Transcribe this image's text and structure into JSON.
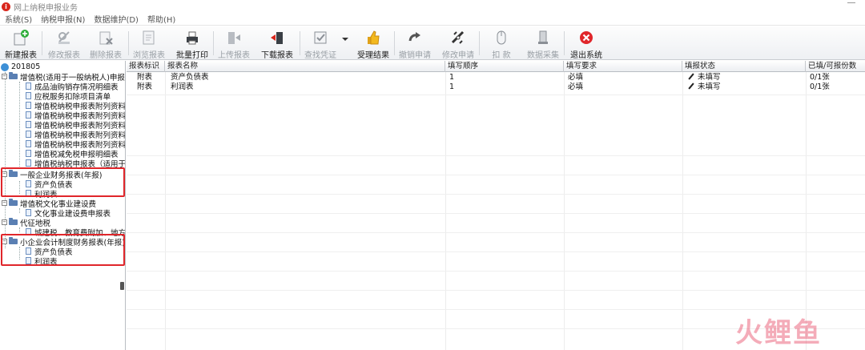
{
  "window": {
    "title": "网上纳税申报业务"
  },
  "menu": [
    "系统(S)",
    "纳税申报(N)",
    "数据维护(D)",
    "帮助(H)"
  ],
  "toolbar": [
    {
      "label": "新建报表",
      "icon": "new-report-icon",
      "enabled": true
    },
    {
      "label": "修改报表",
      "icon": "edit-report-icon",
      "enabled": false
    },
    {
      "label": "删除报表",
      "icon": "delete-report-icon",
      "enabled": false
    },
    {
      "label": "浏览报表",
      "icon": "browse-report-icon",
      "enabled": false
    },
    {
      "label": "批量打印",
      "icon": "printer-icon",
      "enabled": true
    },
    {
      "label": "上传报表",
      "icon": "upload-icon",
      "enabled": false
    },
    {
      "label": "下载报表",
      "icon": "download-icon",
      "enabled": true
    },
    {
      "label": "查找凭证",
      "icon": "voucher-icon",
      "enabled": false
    },
    {
      "label": "受理结果",
      "icon": "thumbs-up-icon",
      "enabled": true
    },
    {
      "label": "撤销申请",
      "icon": "undo-arrow-icon",
      "enabled": false
    },
    {
      "label": "修改申请",
      "icon": "satellite-icon",
      "enabled": false
    },
    {
      "label": "扣 款",
      "icon": "mouse-icon",
      "enabled": false
    },
    {
      "label": "数据采集",
      "icon": "data-collect-icon",
      "enabled": false
    },
    {
      "label": "退出系统",
      "icon": "exit-icon",
      "enabled": true
    }
  ],
  "tree": {
    "root": "201805",
    "groups": [
      {
        "label": "增值税(适用于一般纳税人)申报",
        "children": [
          "成品油购销存情况明细表",
          "应税服务扣除项目清单",
          "增值税纳税申报表附列资料",
          "增值税纳税申报表附列资料",
          "增值税纳税申报表附列资料",
          "增值税纳税申报表附列资料",
          "增值税纳税申报表附列资料",
          "增值税减免税申报明细表",
          "增值税纳税申报表（适用于"
        ]
      },
      {
        "label": "一般企业财务报表(年报)",
        "children": [
          "资产负债表",
          "利润表"
        ]
      },
      {
        "label": "增值税文化事业建设费",
        "children": [
          "文化事业建设费申报表"
        ]
      },
      {
        "label": "代征地税",
        "children": [
          "城建税、教育费附加、地方"
        ]
      },
      {
        "label": "小企业会计制度财务报表(年报)",
        "children": [
          "资产负债表",
          "利润表"
        ]
      }
    ]
  },
  "grid": {
    "columns": [
      "报表标识",
      "报表名称",
      "填写顺序",
      "填写要求",
      "填报状态",
      "已填/可报份数"
    ],
    "rows": [
      [
        "附表",
        "资产负债表",
        "1",
        "必填",
        "未填写",
        "0/1张"
      ],
      [
        "附表",
        "利润表",
        "1",
        "必填",
        "未填写",
        "0/1张"
      ]
    ]
  },
  "watermark": "火鲤鱼",
  "colors": {
    "highlight": "#e0262b",
    "disabled_text": "#9aa0a6"
  }
}
